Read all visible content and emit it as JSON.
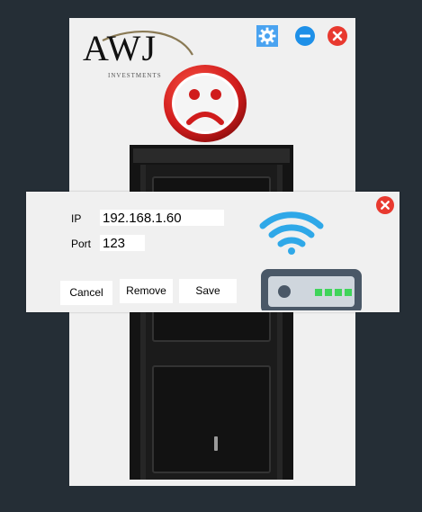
{
  "app": {
    "logo_text": "AWJ",
    "logo_subtext": "INVESTMENTS"
  },
  "window_controls": {
    "settings_icon": "gear-icon",
    "minimize_icon": "minus-circle-icon",
    "close_icon": "close-circle-icon"
  },
  "status": {
    "icon": "sad-face-icon",
    "color": "#d01c1c"
  },
  "door": {
    "icon": "door-icon",
    "color": "#1b1b1b"
  },
  "connection_dialog": {
    "ip_label": "IP",
    "ip_value": "192.168.1.60",
    "port_label": "Port",
    "port_value": "123",
    "cancel_label": "Cancel",
    "remove_label": "Remove",
    "save_label": "Save",
    "close_icon": "close-circle-icon",
    "router_icon": "wifi-router-icon"
  },
  "colors": {
    "background": "#252e36",
    "window": "#f0f0f0",
    "close_red": "#e8392f",
    "minimize_blue": "#1e90e8",
    "settings_blue": "#4aa3f0",
    "wifi_blue": "#2fa8e8",
    "router_body": "#4a5867",
    "router_led": "#3fd45a"
  }
}
